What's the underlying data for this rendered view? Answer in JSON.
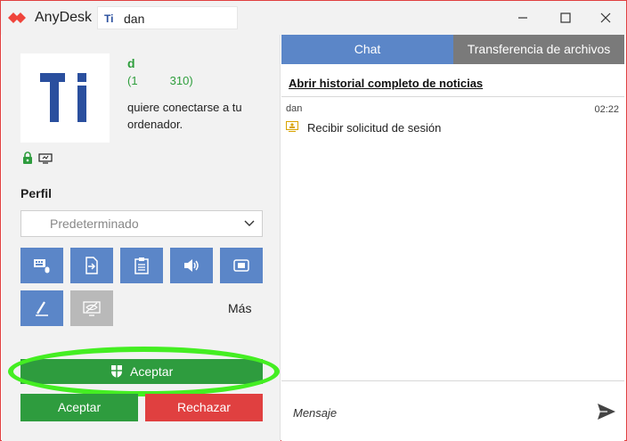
{
  "app": {
    "title": "AnyDesk",
    "session_badge": "Ti",
    "session_user": "dan",
    "brand_color": "#e04040"
  },
  "caller": {
    "name": "d",
    "id": "(1          310)",
    "request_text": "quiere conectarse a tu ordenador."
  },
  "profile": {
    "label": "Perfil",
    "selected": "Predeterminado"
  },
  "permissions": {
    "items": [
      {
        "icon": "keyboard-mouse-icon",
        "enabled": true
      },
      {
        "icon": "file-transfer-icon",
        "enabled": true
      },
      {
        "icon": "clipboard-icon",
        "enabled": true
      },
      {
        "icon": "speaker-icon",
        "enabled": true
      },
      {
        "icon": "record-session-icon",
        "enabled": true
      },
      {
        "icon": "pen-draw-icon",
        "enabled": true
      },
      {
        "icon": "privacy-mode-icon",
        "enabled": false
      }
    ],
    "more_label": "Más"
  },
  "actions": {
    "accept_main": "Aceptar",
    "accept": "Aceptar",
    "reject": "Rechazar",
    "accept_color": "#2e9c3e",
    "reject_color": "#e04040"
  },
  "tabs": {
    "chat": "Chat",
    "files": "Transferencia de archivos"
  },
  "chat": {
    "history_link": "Abrir historial completo de noticias",
    "message": {
      "user": "dan",
      "time": "02:22",
      "text": "Recibir solicitud de sesión"
    },
    "input_placeholder": "Mensaje"
  }
}
